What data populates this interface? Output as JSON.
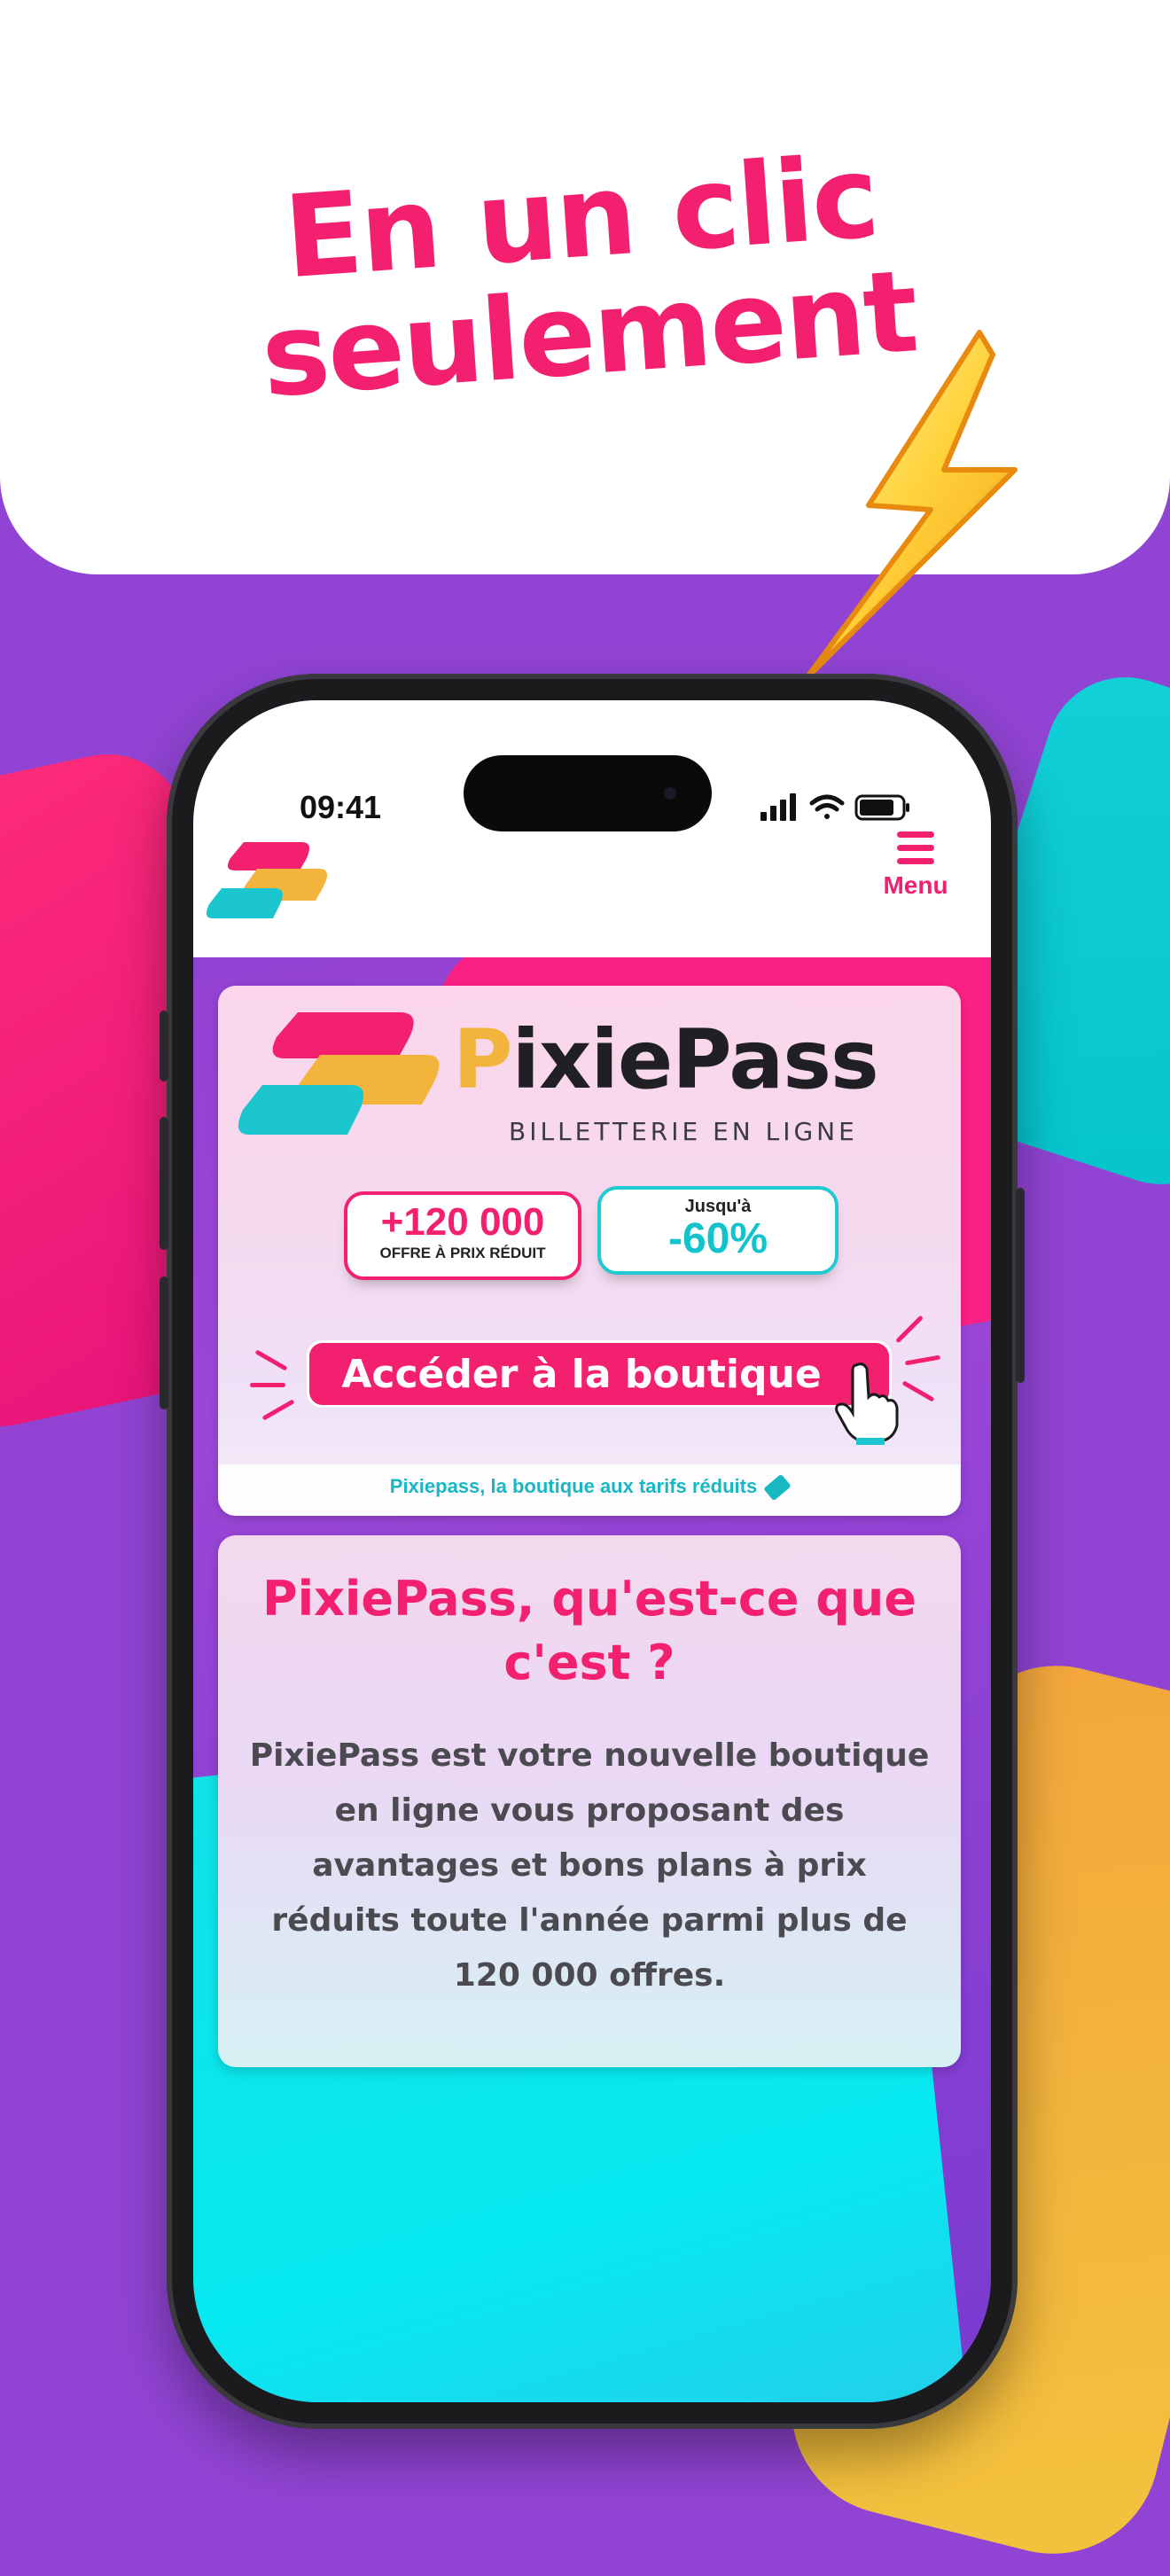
{
  "headline": {
    "line1": "En un clic",
    "line2": "seulement"
  },
  "status_bar": {
    "time": "09:41"
  },
  "header": {
    "menu_label": "Menu"
  },
  "banner": {
    "brand_name": "PixiePass",
    "brand_tagline": "BILLETTERIE EN LIGNE",
    "offers_badge": {
      "value": "+120 000",
      "label": "OFFRE À PRIX RÉDUIT"
    },
    "discount_badge": {
      "label": "Jusqu'à",
      "value": "-60%"
    },
    "shop_button": "Accéder à la boutique",
    "footer_text": "Pixiepass, la boutique aux tarifs réduits"
  },
  "info": {
    "title": "PixiePass, qu'est-ce que c'est ?",
    "text": "PixiePass est votre nouvelle boutique en ligne vous proposant des avantages et bons plans à prix réduits toute l'année parmi plus de 120 000 offres."
  },
  "colors": {
    "brand_pink": "#f3206f",
    "brand_cyan": "#12c3cc",
    "brand_yellow": "#f3b43d",
    "background_purple": "#9144d3"
  },
  "icons": [
    "lightning-bolt-icon",
    "menu-hamburger-icon",
    "signal-icon",
    "wifi-icon",
    "battery-icon",
    "pointing-hand-icon",
    "ticket-icon"
  ]
}
